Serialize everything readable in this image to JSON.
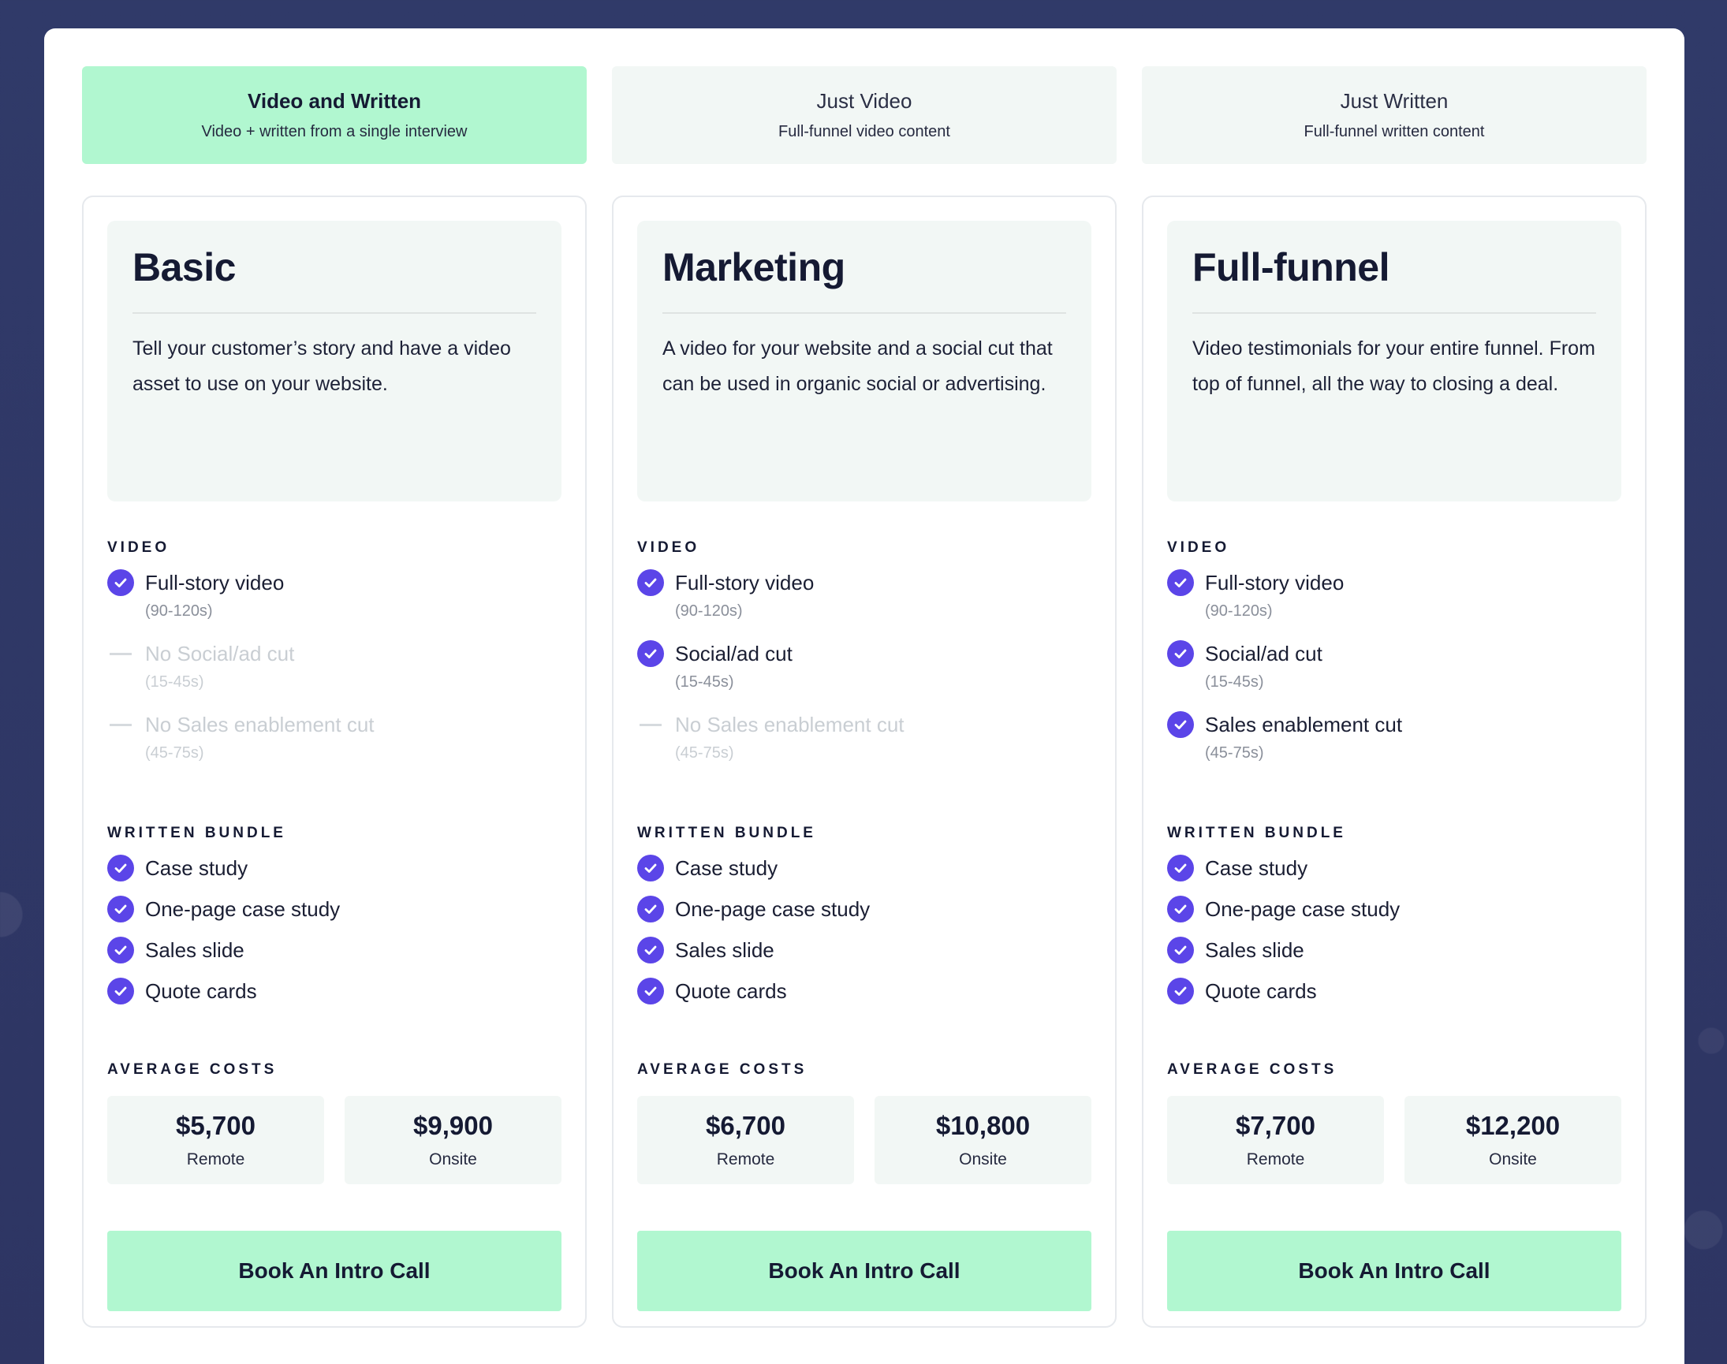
{
  "tabs": [
    {
      "title": "Video and Written",
      "subtitle": "Video + written from a single interview",
      "active": true
    },
    {
      "title": "Just Video",
      "subtitle": "Full-funnel video content",
      "active": false
    },
    {
      "title": "Just Written",
      "subtitle": "Full-funnel written content",
      "active": false
    }
  ],
  "labels": {
    "video": "VIDEO",
    "written": "WRITTEN BUNDLE",
    "costs": "AVERAGE COSTS",
    "remote": "Remote",
    "onsite": "Onsite",
    "cta": "Book An Intro Call"
  },
  "plans": [
    {
      "name": "Basic",
      "description": "Tell your customer’s story and have a video asset to use on your website.",
      "video": [
        {
          "label": "Full-story video",
          "note": "(90-120s)",
          "included": true
        },
        {
          "label": "No Social/ad cut",
          "note": "(15-45s)",
          "included": false
        },
        {
          "label": "No Sales enablement cut",
          "note": "(45-75s)",
          "included": false
        }
      ],
      "written": [
        "Case study",
        "One-page case study",
        "Sales slide",
        "Quote cards"
      ],
      "costs": {
        "remote": "$5,700",
        "onsite": "$9,900"
      }
    },
    {
      "name": "Marketing",
      "description": "A video for your website and a social cut that can be used in organic social or advertising.",
      "video": [
        {
          "label": "Full-story video",
          "note": "(90-120s)",
          "included": true
        },
        {
          "label": "Social/ad cut",
          "note": "(15-45s)",
          "included": true
        },
        {
          "label": "No Sales enablement cut",
          "note": "(45-75s)",
          "included": false
        }
      ],
      "written": [
        "Case study",
        "One-page case study",
        "Sales slide",
        "Quote cards"
      ],
      "costs": {
        "remote": "$6,700",
        "onsite": "$10,800"
      }
    },
    {
      "name": "Full-funnel",
      "description": "Video testimonials for your entire funnel. From top of funnel, all the way to closing a deal.",
      "video": [
        {
          "label": "Full-story video",
          "note": "(90-120s)",
          "included": true
        },
        {
          "label": "Social/ad cut",
          "note": "(15-45s)",
          "included": true
        },
        {
          "label": "Sales enablement cut",
          "note": "(45-75s)",
          "included": true
        }
      ],
      "written": [
        "Case study",
        "One-page case study",
        "Sales slide",
        "Quote cards"
      ],
      "costs": {
        "remote": "$7,700",
        "onsite": "$12,200"
      }
    }
  ],
  "colors": {
    "accent": "#b1f7d0",
    "check": "#5b45e8",
    "background": "#2f3867"
  }
}
